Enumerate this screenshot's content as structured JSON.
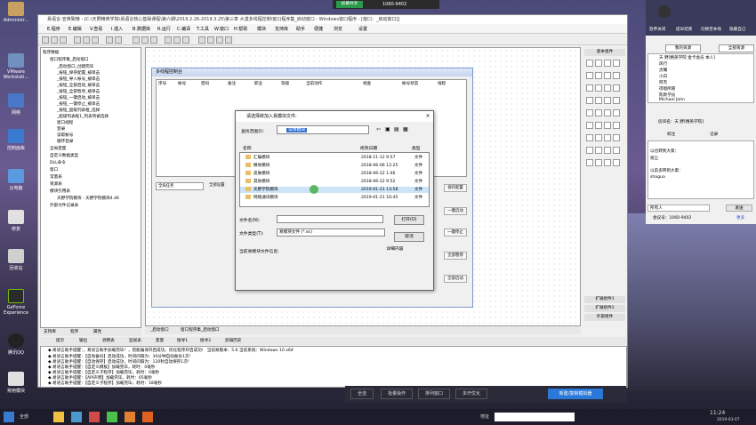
{
  "desktop": {
    "icons": [
      {
        "label": "Administr..."
      },
      {
        "label": "VMware Workstati..."
      },
      {
        "label": "网络"
      },
      {
        "label": "控制面板"
      },
      {
        "label": "云电脑"
      },
      {
        "label": "修复"
      },
      {
        "label": "回收站"
      },
      {
        "label": "GeForce Experience"
      },
      {
        "label": "腾讯QQ"
      },
      {
        "label": "常用模块"
      }
    ]
  },
  "share_bar": {
    "label": "屏幕共享",
    "id_text": "1060-9402"
  },
  "ide": {
    "title": "易语言-宣英致精 - [C:\\天野精英学院\\易语言核心基础课程\\第六期\\2019.2.26-2019.3.25\\第三章 大漠多线程控制\\窗口程序集_启动窗口 - Windows窗口程序 - [窗口：_启动窗口]]",
    "menu": [
      "E.程序",
      "E.编辑",
      "V.查看",
      "I.插入",
      "B.数据库",
      "R.运行",
      "C.编译",
      "T.工具",
      "W.窗口",
      "H.帮助",
      "模块",
      "支持库",
      "助手",
      "便捷",
      "浏览",
      "设置"
    ],
    "tree": [
      "程序数据",
      "窗口程序集_启动窗口",
      "_启动窗口_创建完毕",
      "_按钮_保存配置_被单击",
      "_按钮_导入帐号_被单击",
      "_按钮_全部启动_被单击",
      "_按钮_全部暂停_被单击",
      "_按钮_一键启动_被单击",
      "_按钮_一键停止_被单击",
      "_按钮_超级列表框_选择",
      "_超级列表框1_列表项被选择",
      "窗口线程",
      "登录",
      "读取帐号",
      "循环登录",
      "全局变量",
      "自定义数据类型",
      "DLL命令",
      "窗口",
      "常量表",
      "资源表",
      "模块引用表",
      "天野学院模块 - 天野学院模块4.46",
      "外部文件记录表"
    ],
    "tree_tabs": [
      "支持库",
      "程序",
      "属性"
    ],
    "design_tabs": [
      "_启动窗口",
      "窗口程序集_启动窗口"
    ],
    "form": {
      "title": "多线程控制台",
      "columns": [
        "序号",
        "帐号",
        "密码",
        "备注",
        "职业",
        "等级",
        "当前动作",
        "视金",
        "帐号状态",
        "线程"
      ],
      "group_label": "全局任务",
      "all_label": "全部设置",
      "buttons": [
        "保存配置",
        "一键启动",
        "一键停止",
        "全部暂停",
        "全部启动"
      ]
    },
    "props_labels": [
      "基本组件",
      "扩展组件1",
      "扩展组件2",
      "外部组件"
    ],
    "output_tabs": [
      "提示",
      "输出",
      "调用表",
      "监视表",
      "变量",
      "搜寻1",
      "搜寻2",
      "剪辑历史"
    ],
    "output_lines": [
      "◆.易语言助手提醒：，易语言助手加载完毕！，智能编译开启成功，优化程序开启成功！ 当前易版本：5.6 当前系统：Windows 10 x64",
      "◆.易语言助手提醒：【自动备份】启动成功，时间间隔为：30分钟自动备份1次!",
      "◆.易语言助手提醒：【自动保存】启动成功，时间间隔为：120秒自动保存1次!",
      "◆.易语言助手提醒：【自定义模板】加载完毕，耗时：0毫秒",
      "◆.易语言助手提醒：【自定义子程序】加载完毕，耗时：0毫秒",
      "◆.易语言助手提醒：【API声明】加载完毕，耗时：65毫秒",
      "◆.易语言助手提醒：【自定义子程序】加载完毕，耗时：18毫秒"
    ]
  },
  "dialog": {
    "title": "请选择欲加入易模块文件:",
    "look_in_label": "查找范围(I):",
    "look_in_value": "常用模块",
    "headers": [
      "名称",
      "修改日期",
      "类型"
    ],
    "files": [
      {
        "name": "汇编模块",
        "date": "2018-11-12 9:57",
        "type": "文件"
      },
      {
        "name": "精易模块",
        "date": "2018-06-06 12:25",
        "type": "文件"
      },
      {
        "name": "皮肤模块",
        "date": "2018-06-22 1:46",
        "type": "文件"
      },
      {
        "name": "其他模块",
        "date": "2018-06-22 9:52",
        "type": "文件"
      },
      {
        "name": "天野学院模块",
        "date": "2019-01-21 13:58",
        "type": "文件"
      },
      {
        "name": "网络通讯模块",
        "date": "2019-01-21 16:45",
        "type": "文件"
      }
    ],
    "filename_label": "文件名(N):",
    "filename_value": "",
    "filetype_label": "文件类型(T):",
    "filetype_value": "易模块文件 (*.ec)",
    "info_label": "当前易模块文件信息:",
    "open_button": "打开(O)",
    "cancel_button": "取消",
    "detail_button": "详细内容"
  },
  "right_panel": {
    "top_buttons": [
      "放弃关闭",
      "提早结束",
      "切换至本地",
      "隐藏自己"
    ],
    "tabs": [
      "我的资源",
      "全部资源"
    ],
    "users": [
      "天 野[精英学院 金卡会员 本人]",
      "风行",
      "灵曦",
      "小白",
      "阿杰",
      "得偿所愿",
      "陈默学员",
      "Michael John"
    ],
    "room": "房间名：天 野[精英学院]",
    "mark_label": "标注",
    "record_label": "记录",
    "chat_lines": [
      "以也转到大家：",
      "很尘",
      "以前多转到大家：",
      "shagua"
    ],
    "send_target": "所有人",
    "send_button": "发送",
    "room_number_label": "会议号：1060-9402",
    "more": "更多"
  },
  "record_bar": {
    "buttons": [
      "全选",
      "批量操作",
      "排列窗口",
      "多开优化",
      "新建/复制模拟器"
    ]
  },
  "taskbar": {
    "start_label": "全部",
    "time": "11:24",
    "date": "2019-03-07",
    "address_label": "地址"
  }
}
